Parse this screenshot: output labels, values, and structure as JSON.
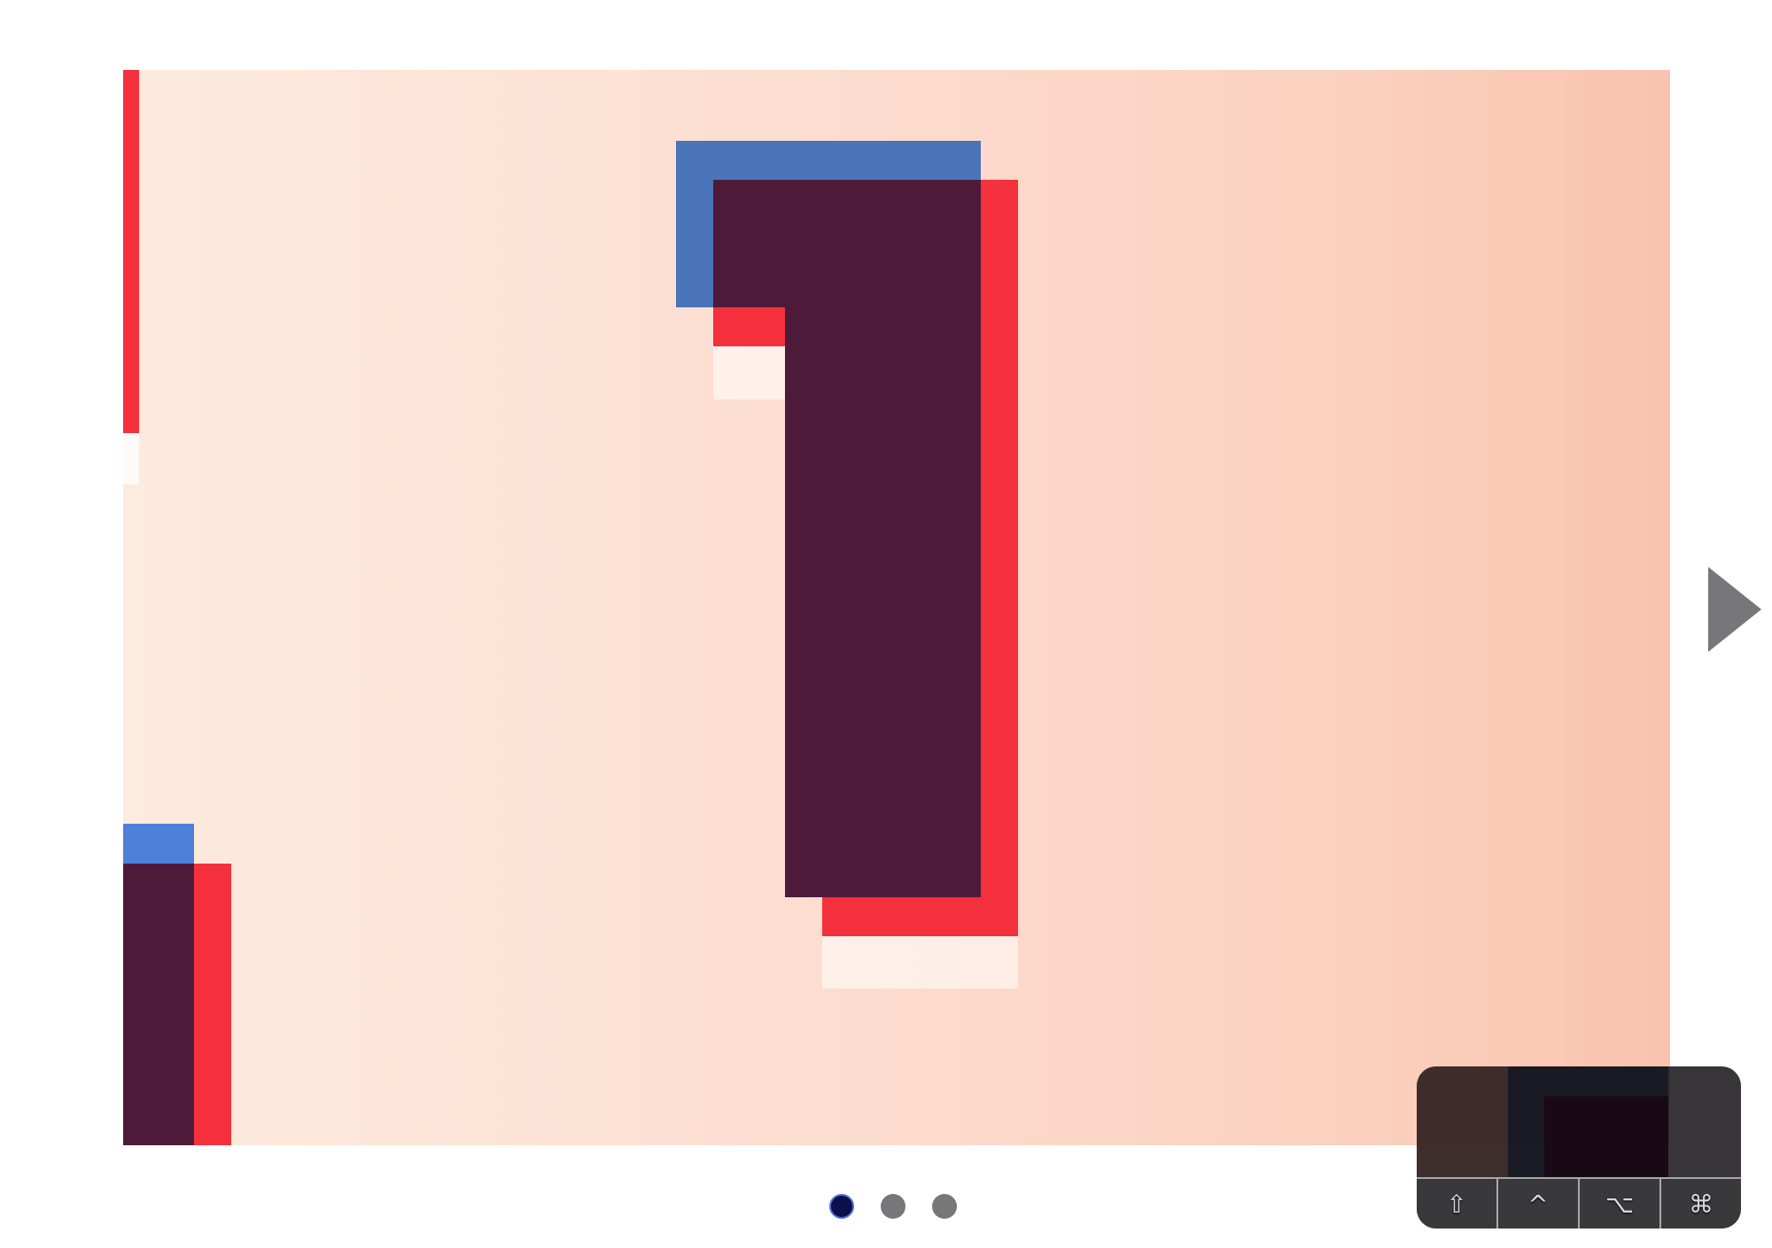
{
  "slideshow": {
    "current_slide_glyph": "1",
    "slide_count": 3,
    "active_index": 0,
    "next_label": "next-slide"
  },
  "indicators": [
    {
      "label": "slide-1",
      "active": true
    },
    {
      "label": "slide-2",
      "active": false
    },
    {
      "label": "slide-3",
      "active": false
    }
  ],
  "modifier_keys": [
    {
      "name": "shift",
      "glyph": "⇧"
    },
    {
      "name": "control",
      "glyph": "^"
    },
    {
      "name": "option",
      "glyph": "⌥"
    },
    {
      "name": "command",
      "glyph": "⌘"
    }
  ],
  "colors": {
    "glyph_dark": "#4d1a3a",
    "glyph_blue": "#4a74b9",
    "glyph_red": "#f5303d",
    "background_start": "#fdebde",
    "background_end": "#f9c3ae",
    "active_dot": "#0c0f4a",
    "inactive_dot": "#77777a",
    "arrow": "#77777a"
  }
}
